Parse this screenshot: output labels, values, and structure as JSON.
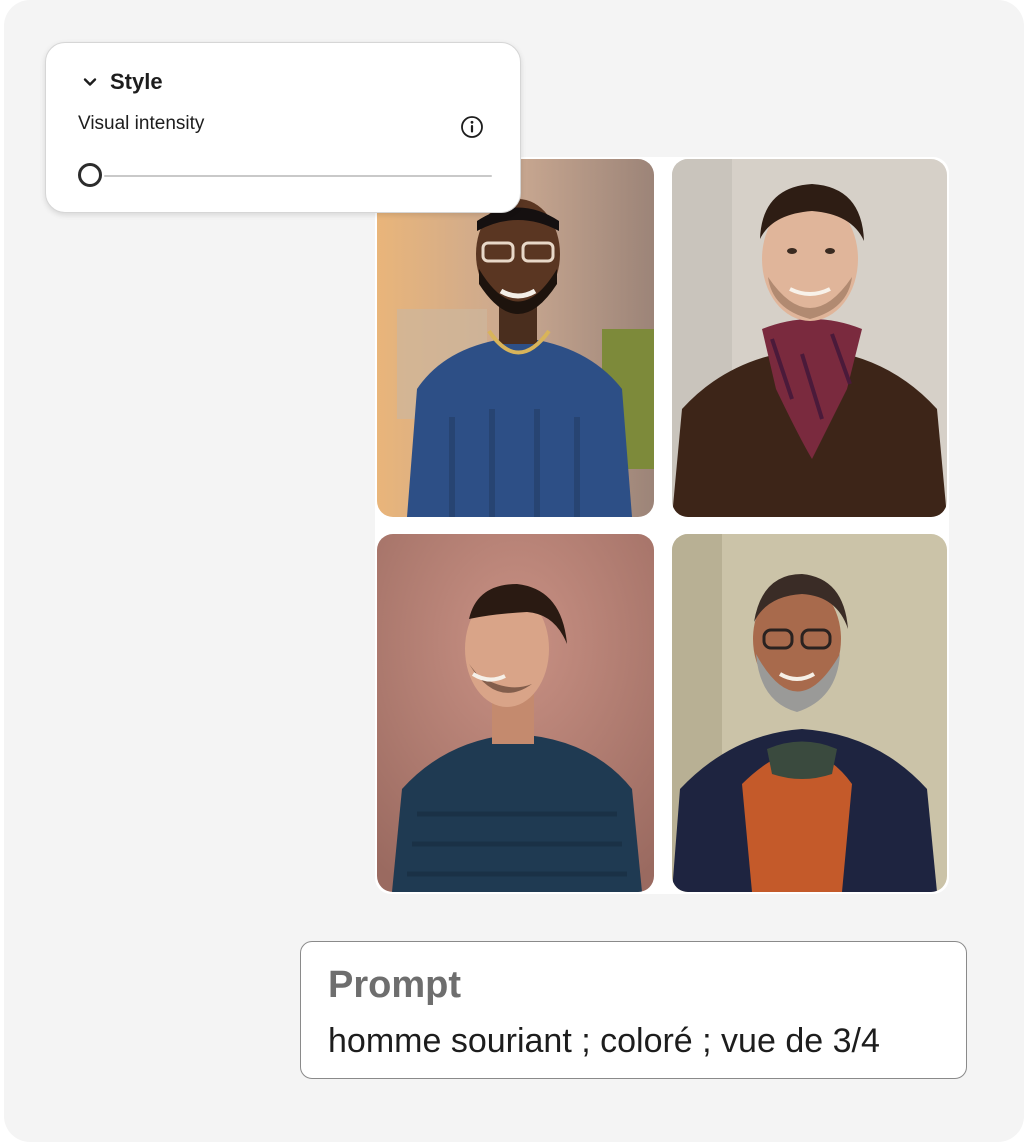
{
  "style_panel": {
    "title": "Style",
    "intensity_label": "Visual intensity",
    "intensity_value": 0
  },
  "images": [
    {
      "id": "image-1"
    },
    {
      "id": "image-2"
    },
    {
      "id": "image-3"
    },
    {
      "id": "image-4"
    }
  ],
  "prompt": {
    "label": "Prompt",
    "text": "homme souriant ; coloré ; vue de 3/4"
  },
  "colors": {
    "background": "#f4f4f4",
    "panel": "#ffffff",
    "text": "#1d1d1d",
    "prompt_label": "#6e6e6e"
  }
}
